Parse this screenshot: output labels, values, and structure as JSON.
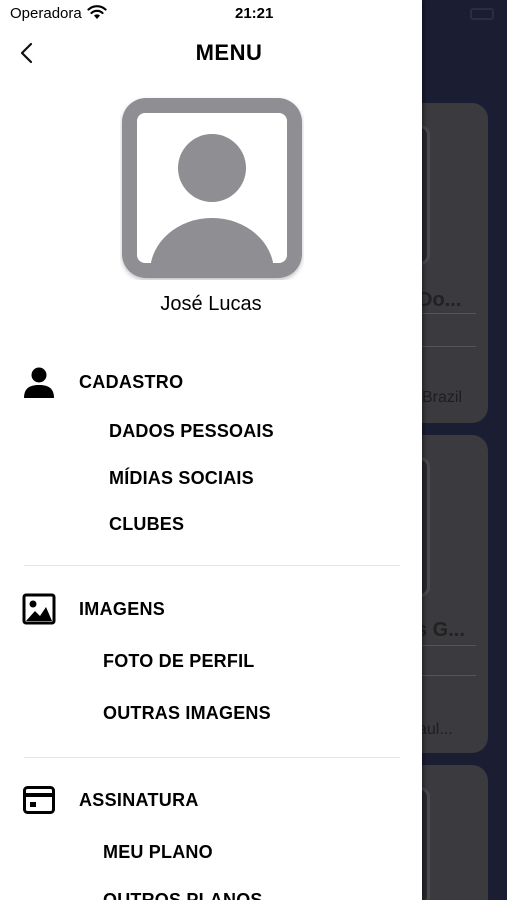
{
  "status_bar": {
    "carrier": "Operadora",
    "time": "21:21"
  },
  "header": {
    "title": "MENU"
  },
  "profile": {
    "name": "José Lucas"
  },
  "sections": [
    {
      "label": "CADASTRO",
      "icon": "person-icon",
      "items": [
        "DADOS PESSOAIS",
        "MÍDIAS SOCIAIS",
        "CLUBES"
      ]
    },
    {
      "label": "IMAGENS",
      "icon": "image-icon",
      "items": [
        "FOTO DE PERFIL",
        "OUTRAS IMAGENS"
      ]
    },
    {
      "label": "ASSINATURA",
      "icon": "card-icon",
      "items": [
        "MEU PLANO",
        "OUTROS PLANOS"
      ]
    }
  ],
  "background": {
    "cards": [
      {
        "title": "Do...",
        "subtitle": "Brazil"
      },
      {
        "title": "s G...",
        "subtitle": "aul..."
      }
    ]
  },
  "colors": {
    "drawer": "#ffffff",
    "backdrop": "#1b1e33",
    "avatar_gray": "#8e8e93",
    "text": "#000000"
  }
}
